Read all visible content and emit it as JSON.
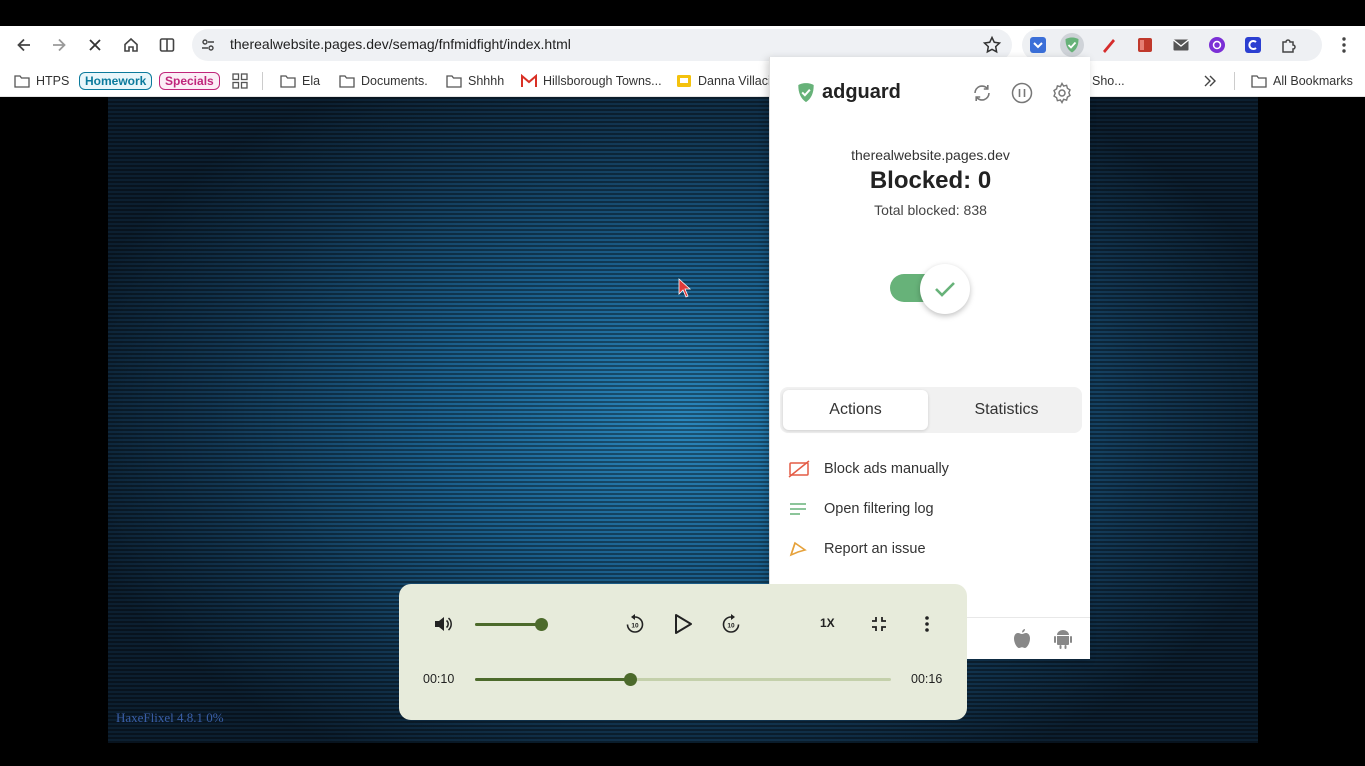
{
  "browser": {
    "url": "therealwebsite.pages.dev/semag/fnfmidfight/index.html",
    "nav": {
      "back": "back-arrow-icon",
      "forward": "forward-arrow-icon",
      "stop": "close-icon",
      "home": "home-icon",
      "reader": "side-panel-icon"
    }
  },
  "bookmarks": {
    "items": [
      {
        "label": "HTPS",
        "icon": "folder-link-icon"
      },
      {
        "label": "Homework",
        "color": "#0b7a9c"
      },
      {
        "label": "Specials",
        "color": "#c0267b"
      },
      {
        "label": "Ela",
        "icon": "folder-icon"
      },
      {
        "label": "Documents.",
        "icon": "folder-icon"
      },
      {
        "label": "Shhhh",
        "icon": "folder-icon"
      },
      {
        "label": "Hillsborough Towns...",
        "icon": "gmail-icon"
      },
      {
        "label": "Danna Villaci",
        "icon": "classroom-icon"
      },
      {
        "label": "Sho...",
        "icon": "folder-icon"
      }
    ],
    "all_bookmarks": "All Bookmarks"
  },
  "game": {
    "loader_text": "HaxeFlixel 4.8.1 0%"
  },
  "adguard": {
    "brand": "adguard",
    "site": "therealwebsite.pages.dev",
    "blocked": "Blocked: 0",
    "total_blocked": "Total blocked: 838",
    "protection_enabled": true,
    "tabs": [
      {
        "label": "Actions",
        "active": true
      },
      {
        "label": "Statistics",
        "active": false
      }
    ],
    "actions": [
      {
        "label": "Block ads manually",
        "icon": "block-ad-icon"
      },
      {
        "label": "Open filtering log",
        "icon": "list-icon"
      },
      {
        "label": "Report an issue",
        "icon": "report-icon"
      }
    ],
    "footer_icons": [
      "apple-icon",
      "android-icon"
    ]
  },
  "media": {
    "current_time": "00:10",
    "duration": "00:16",
    "progress_fraction": 0.373,
    "volume_fraction": 0.92,
    "speed": "1X"
  },
  "colors": {
    "accent_green": "#4c6a2b",
    "adguard_green": "#67b279",
    "game_blue": "#2a86bb"
  }
}
